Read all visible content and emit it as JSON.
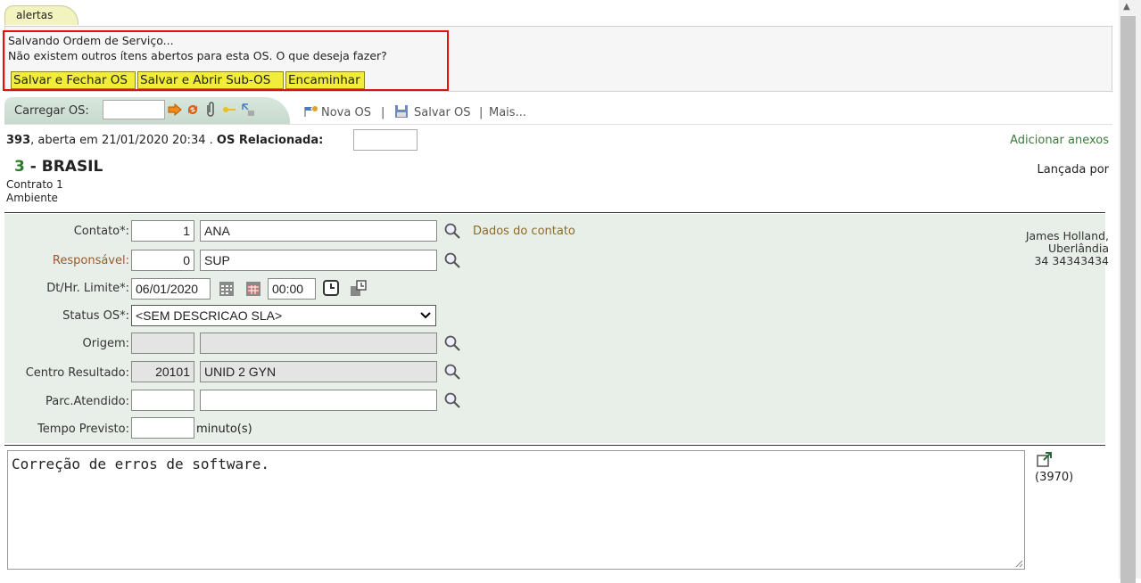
{
  "tab": {
    "label": "alertas"
  },
  "alert": {
    "line1": "Salvando Ordem de Serviço...",
    "line2": "Não existem outros ítens abertos para esta OS. O que deseja fazer?",
    "buttons": [
      "Salvar e Fechar OS",
      "Salvar e Abrir Sub-OS",
      "Encaminhar"
    ]
  },
  "toolbar": {
    "load_label": "Carregar OS:",
    "new_os": "Nova OS",
    "save_os": "Salvar OS",
    "more": "Mais...",
    "sep": "|"
  },
  "os": {
    "number": "393",
    "opened_text": ", aberta em 21/01/2020 20:34 . ",
    "related_label": "OS Relacionada:",
    "add_attachments": "Adicionar anexos",
    "client_num": "3",
    "client_name": " - BRASIL",
    "launched_by": "Lançada por",
    "contract": "Contrato 1",
    "environment": "Ambiente"
  },
  "form": {
    "contato": {
      "label": "Contato*:",
      "code": "1",
      "name": "ANA",
      "link": "Dados do contato"
    },
    "responsavel": {
      "label": "Responsável:",
      "code": "0",
      "name": "SUP"
    },
    "limite": {
      "label": "Dt/Hr. Limite*:",
      "date": "06/01/2020",
      "time": "00:00"
    },
    "status": {
      "label": "Status OS*:",
      "value": "<SEM DESCRICAO SLA>"
    },
    "origem": {
      "label": "Origem:",
      "code": "",
      "name": ""
    },
    "centro": {
      "label": "Centro Resultado:",
      "code": "20101",
      "name": "UNID 2 GYN"
    },
    "parc": {
      "label": "Parc.Atendido:",
      "code": "",
      "name": ""
    },
    "tempo": {
      "label": "Tempo Previsto:",
      "value": "",
      "unit": "minuto(s)"
    }
  },
  "address": {
    "name": "James Holland,",
    "city": "Uberlândia",
    "phone": "34 34343434"
  },
  "description": {
    "text": "Correção de erros de software.",
    "count": "(3970)"
  }
}
